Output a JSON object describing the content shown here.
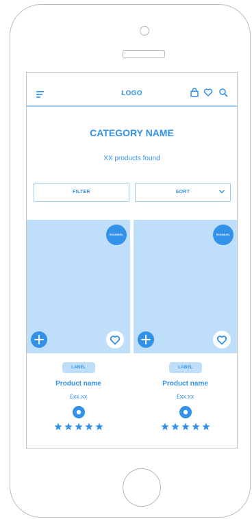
{
  "header": {
    "logo": "LOGO",
    "icons": [
      "menu-icon",
      "bag-icon",
      "heart-icon",
      "search-icon"
    ]
  },
  "category": {
    "title": "CATEGORY NAME",
    "count_text": "XX products found"
  },
  "controls": {
    "filter_label": "FILTER",
    "sort_label": "SORT"
  },
  "products": [
    {
      "badge": "ROUNDEL",
      "label": "LABEL",
      "name": "Product name",
      "price": "£xx.xx",
      "rating": 5
    },
    {
      "badge": "ROUNDEL",
      "label": "LABEL",
      "name": "Product name",
      "price": "£xx.xx",
      "rating": 5
    }
  ],
  "colors": {
    "accent": "#3291e8",
    "light_accent": "#bfdef9",
    "frame": "#b9b9b9"
  }
}
